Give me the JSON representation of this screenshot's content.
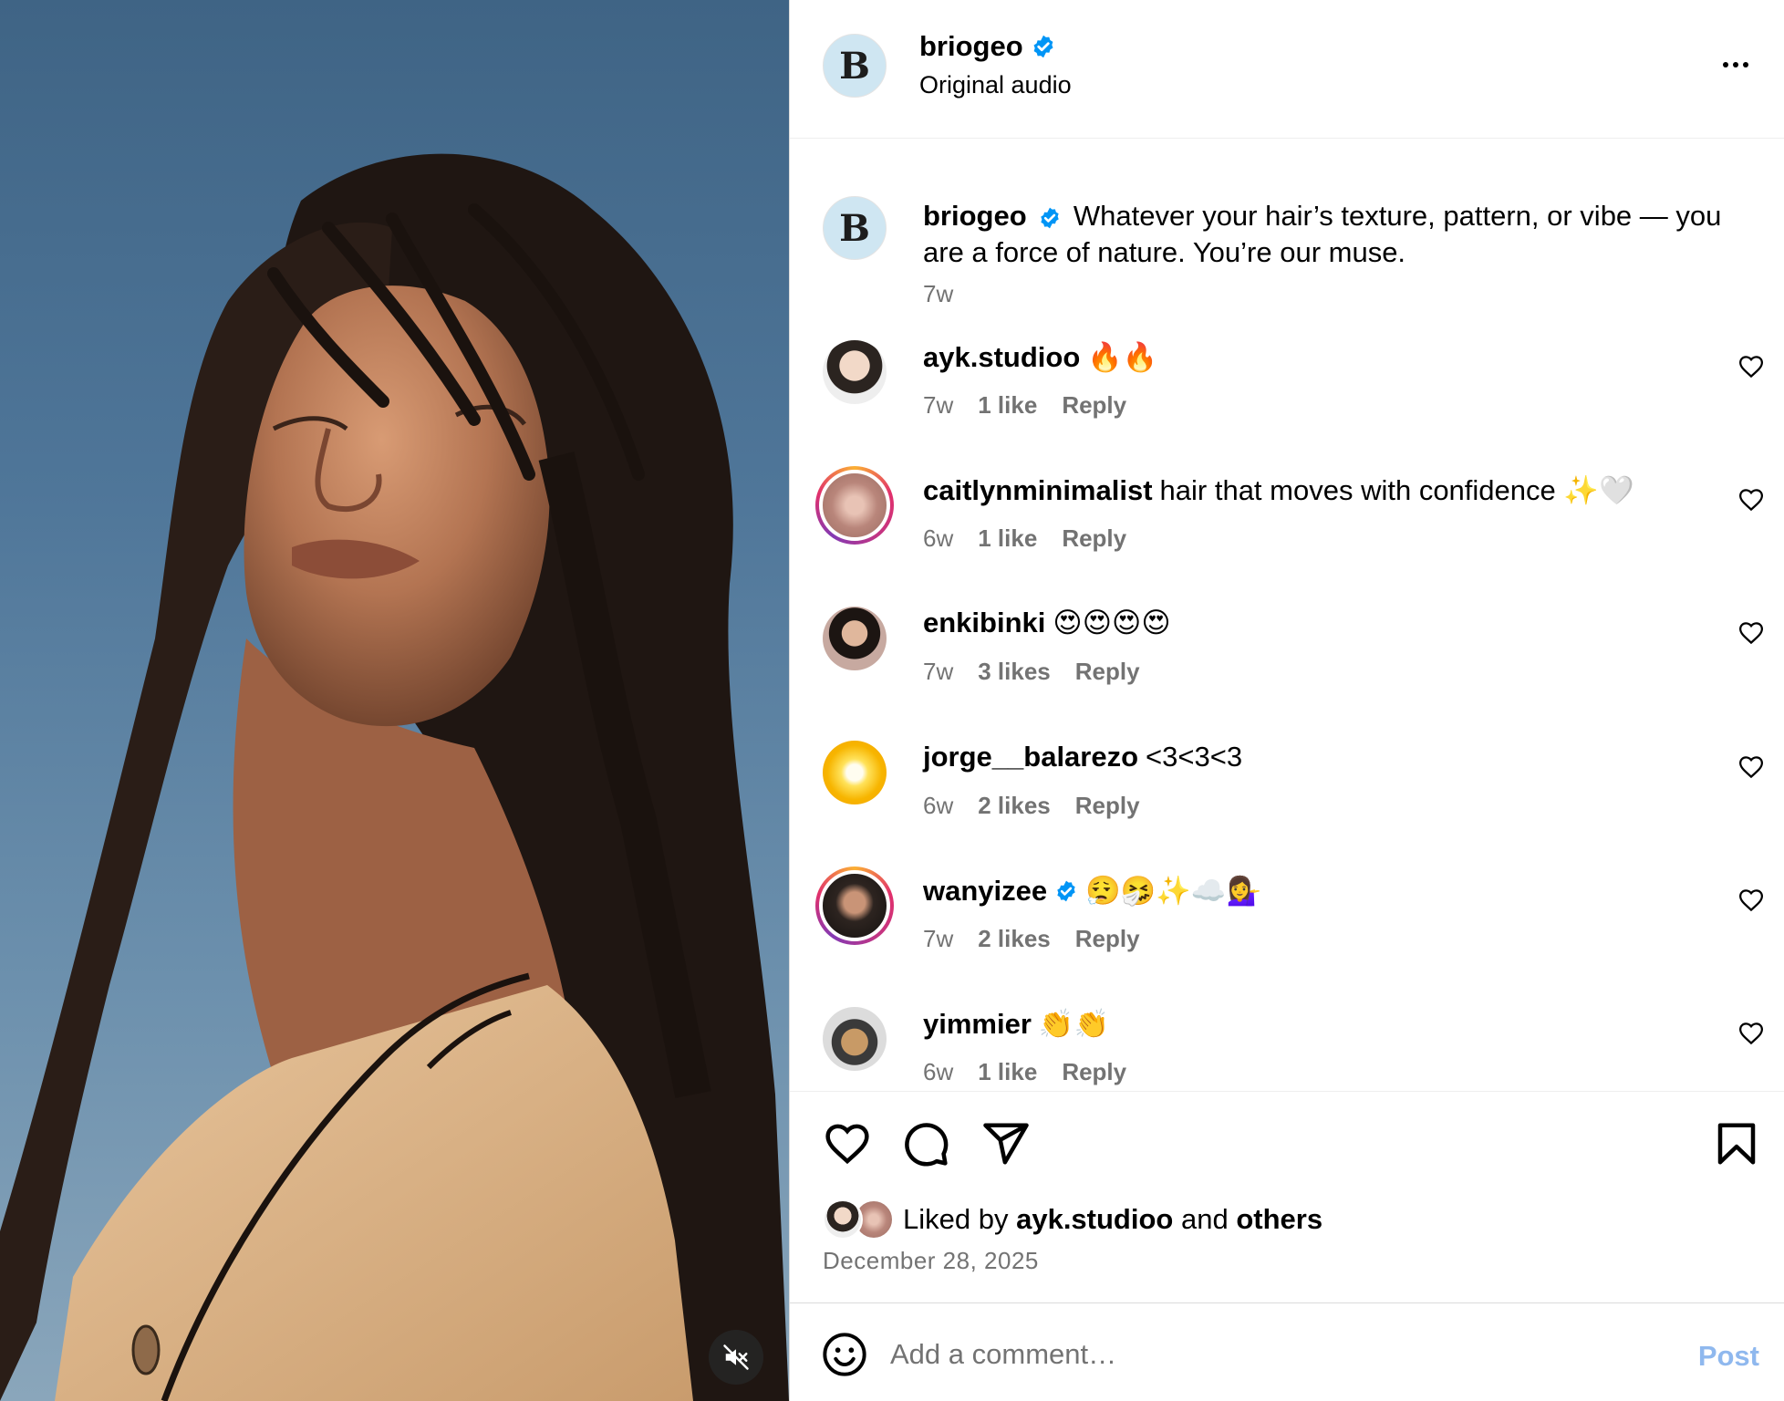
{
  "media": {
    "mute_icon": "speaker-muted-icon",
    "colors": {
      "sky": "#4f7699",
      "hair": "#1f1612",
      "skin": "#b37452"
    }
  },
  "header": {
    "username": "briogeo",
    "subtitle": "Original audio",
    "avatar_letter": "B",
    "more_icon": "more-horizontal-icon"
  },
  "caption": {
    "username": "briogeo",
    "text": "Whatever your hair’s texture, pattern, or vibe — you are a force of nature. You’re our muse.",
    "time": "7w"
  },
  "comments": [
    {
      "username": "ayk.studioo",
      "text": "🔥🔥",
      "time": "7w",
      "likes": "1 like",
      "reply": "Reply",
      "verified": false
    },
    {
      "username": "caitlynminimalist",
      "text": "hair that moves with confidence ✨🤍",
      "time": "6w",
      "likes": "1 like",
      "reply": "Reply",
      "verified": false
    },
    {
      "username": "enkibinki",
      "text": "😍😍😍😍",
      "time": "7w",
      "likes": "3 likes",
      "reply": "Reply",
      "verified": false
    },
    {
      "username": "jorge__balarezo",
      "text": "<3<3<3",
      "time": "6w",
      "likes": "2 likes",
      "reply": "Reply",
      "verified": false
    },
    {
      "username": "wanyizee",
      "text": "😮‍💨🤧✨☁️💁‍♀️",
      "time": "7w",
      "likes": "2 likes",
      "reply": "Reply",
      "verified": true
    },
    {
      "username": "yimmier",
      "text": "👏👏",
      "time": "6w",
      "likes": "1 like",
      "reply": "Reply",
      "verified": false
    }
  ],
  "actions": {
    "liked_prefix": "Liked by",
    "liked_user": "ayk.studioo",
    "liked_and": "and",
    "liked_others": "others",
    "date": "December 28, 2025"
  },
  "composer": {
    "placeholder": "Add a comment…",
    "post_label": "Post"
  },
  "colors": {
    "accent": "#0095f6",
    "post_disabled": "#8fb8ee",
    "muted_text": "#737373",
    "verified": "#0095f6"
  }
}
